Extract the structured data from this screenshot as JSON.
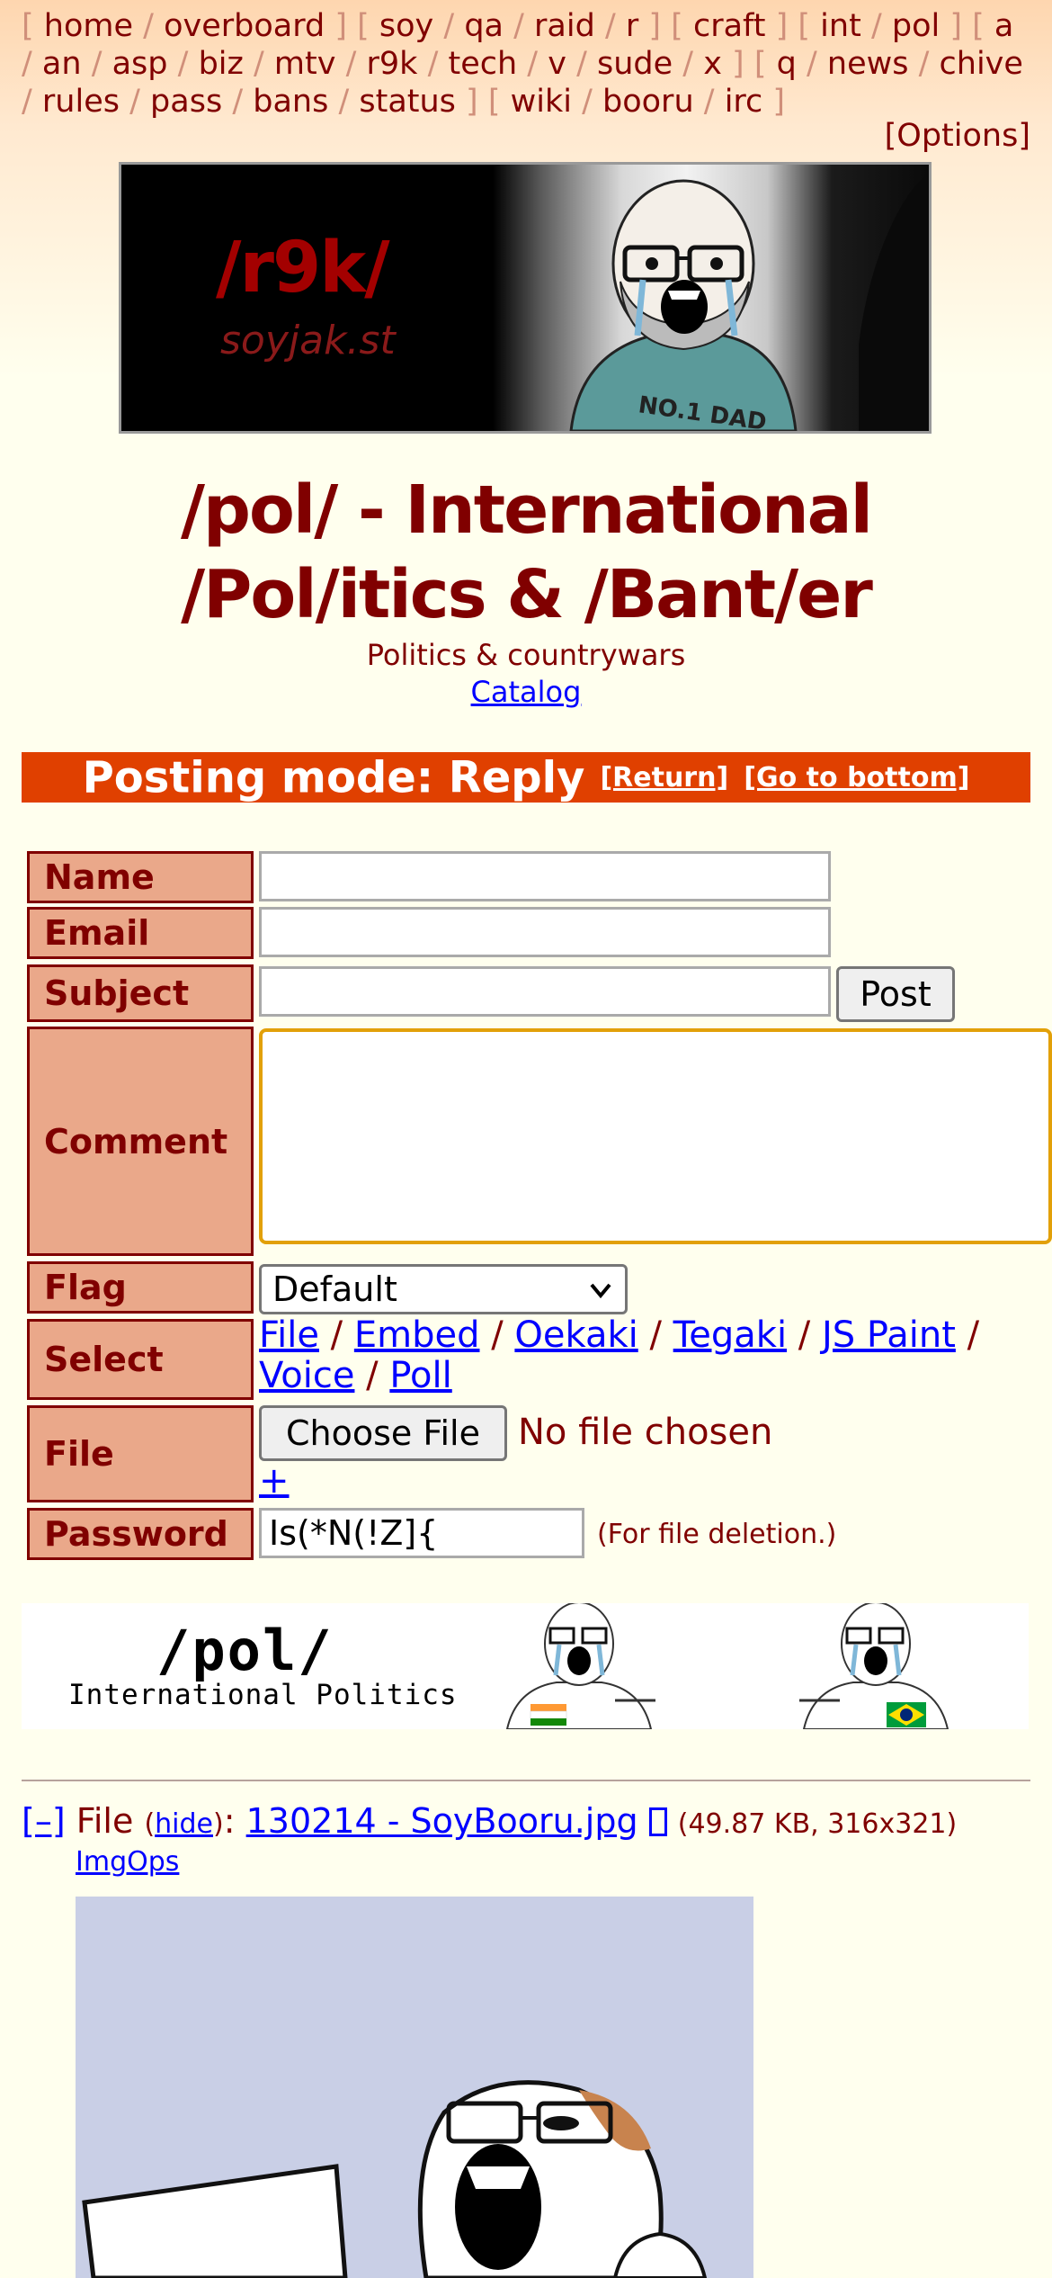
{
  "nav": {
    "groups": [
      [
        "home",
        "overboard"
      ],
      [
        "soy",
        "qa",
        "raid",
        "r"
      ],
      [
        "craft"
      ],
      [
        "int",
        "pol"
      ],
      [
        "a",
        "an",
        "asp",
        "biz",
        "mtv",
        "r9k",
        "tech",
        "v",
        "sude",
        "x"
      ],
      [
        "q",
        "news",
        "chive",
        "rules",
        "pass",
        "bans",
        "status"
      ],
      [
        "wiki",
        "booru",
        "irc"
      ]
    ],
    "options": "[Options]"
  },
  "banner": {
    "board": "/r9k/",
    "site": "soyjak.st",
    "shirt_text": "NO.1 DAD"
  },
  "board": {
    "title": "/pol/ - International /Pol/itics & /Bant/er",
    "subtitle": "Politics & countrywars",
    "catalog_link": "Catalog"
  },
  "posting_mode": {
    "text": "Posting mode: Reply",
    "return_link": "[Return]",
    "bottom_link": "[Go to bottom]"
  },
  "form": {
    "name_label": "Name",
    "email_label": "Email",
    "subject_label": "Subject",
    "post_button": "Post",
    "comment_label": "Comment",
    "flag_label": "Flag",
    "flag_value": "Default",
    "select_label": "Select",
    "select_options": [
      "File",
      "Embed",
      "Oekaki",
      "Tegaki",
      "JS Paint",
      "Voice",
      "Poll"
    ],
    "file_label": "File",
    "choose_file_button": "Choose File",
    "no_file_text": "No file chosen",
    "add_file": "+",
    "password_label": "Password",
    "password_value": "Is(*N(!Z]{",
    "password_note": "(For file deletion.)"
  },
  "board_banner": {
    "title": "/pol/",
    "subtitle": "International Politics"
  },
  "post": {
    "collapse": "[–]",
    "file_prefix": "File",
    "hide_link": "hide",
    "filename": "130214 - SoyBooru.jpg",
    "file_info": "(49.87 KB, 316x321)",
    "imgops": "ImgOps"
  },
  "colors": {
    "accent": "#800000",
    "posting_bar": "#e04000",
    "label_bg": "#eaa88a",
    "link": "#0000ff",
    "page_bg": "#ffffee"
  }
}
